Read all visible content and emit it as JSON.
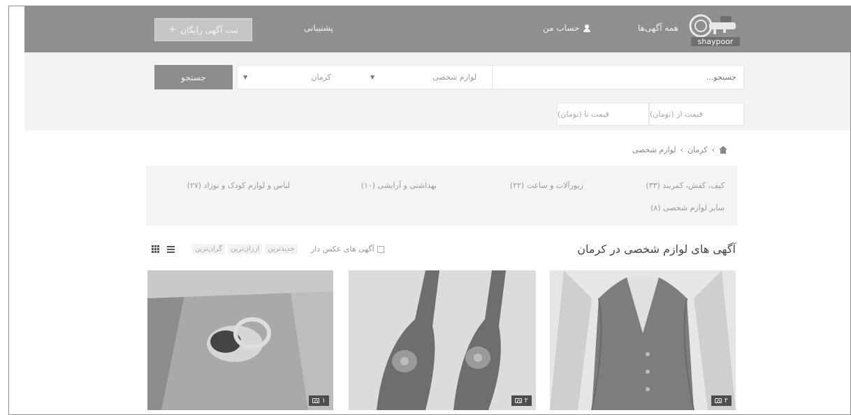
{
  "header": {
    "post_ad_label": "ثبت آگهی رایگان",
    "support_label": "پشتیبانی",
    "account_label": "حساب من",
    "all_ads_label": "همه آگهی‌ها",
    "logo_text": "shaypoor"
  },
  "search": {
    "button_label": "جستجو",
    "placeholder": "جستجو...",
    "city_select": "کرمان",
    "category_select": "لوازم شخصی",
    "price_min_placeholder": "قیمت از (تومان)",
    "price_max_placeholder": "قیمت تا (تومان)"
  },
  "breadcrumb": [
    "کرمان",
    "لوازم شخصی"
  ],
  "subcategories": [
    "کیف، کفش، کمربند (۳۳)",
    "زیورآلات و ساعت (۲۲)",
    "بهداشتی و آرایشی (۱۰)",
    "لباس و لوازم کودک و نوزاد (۲۷)",
    "سایر لوازم شخصی (۸)"
  ],
  "listing": {
    "title": "آگهی های لوازم شخصی در کرمان",
    "photo_filter_label": "آگهی های عکس دار",
    "sort_options": [
      "جدیدترین",
      "ارزان‌ترین",
      "گران‌ترین"
    ]
  },
  "cards": [
    {
      "photo_count": "۲",
      "subject": "vest",
      "camera_icon": "camera-icon"
    },
    {
      "photo_count": "۲",
      "subject": "shoes",
      "camera_icon": "camera-icon"
    },
    {
      "photo_count": "۱",
      "subject": "ring",
      "camera_icon": "camera-icon"
    }
  ],
  "colors": {
    "header_bg": "#8f8f8f",
    "search_band_bg": "#f3f3f3",
    "button_bg": "#8c8c8c"
  }
}
